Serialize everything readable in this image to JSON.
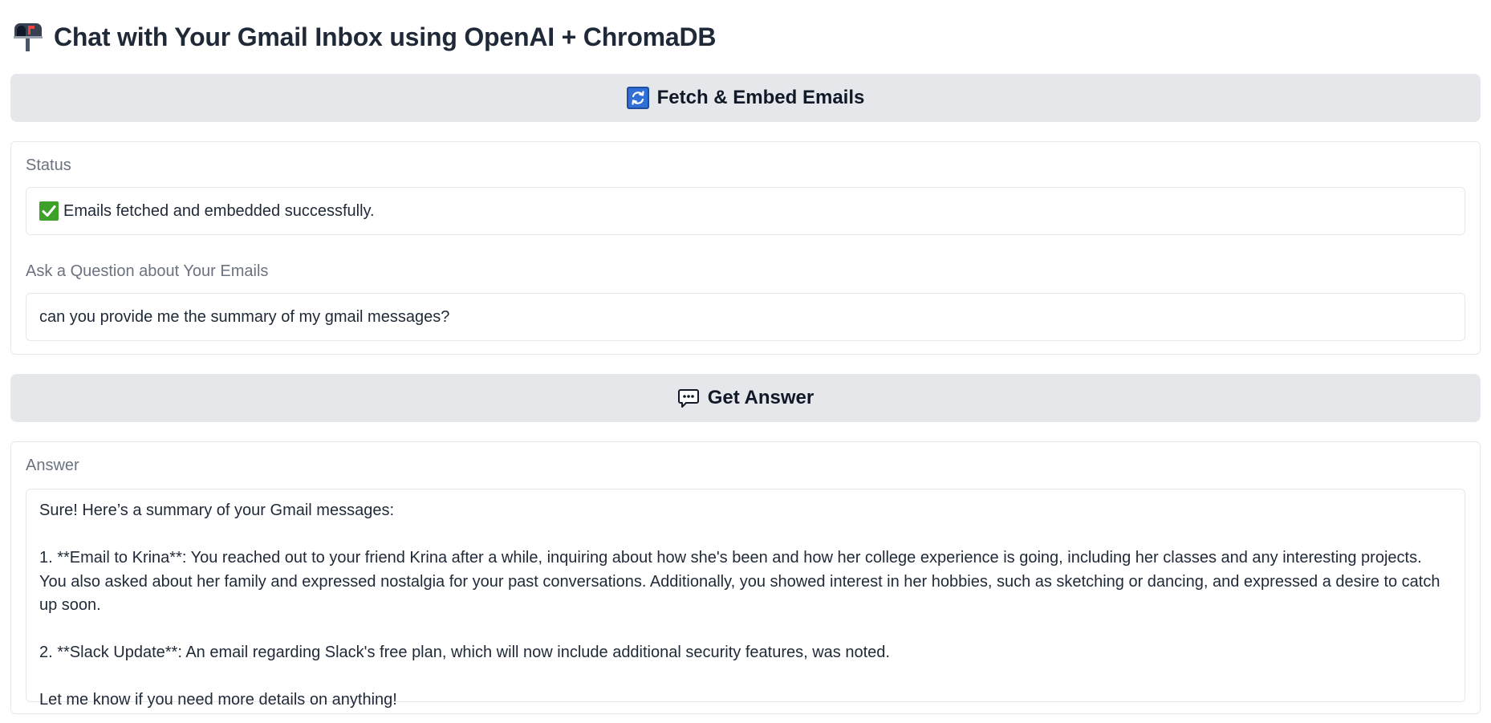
{
  "header": {
    "title": "Chat with Your Gmail Inbox using OpenAI + ChromaDB",
    "icon": "mailbox-icon"
  },
  "fetch_button": {
    "label": "Fetch & Embed Emails",
    "icon": "refresh-icon"
  },
  "status": {
    "label": "Status",
    "value": "Emails fetched and embedded successfully.",
    "icon": "check-icon"
  },
  "question": {
    "label": "Ask a Question about Your Emails",
    "value": "can you provide me the summary of my gmail messages?"
  },
  "answer_button": {
    "label": "Get Answer",
    "icon": "speech-bubble-icon"
  },
  "answer": {
    "label": "Answer",
    "paragraphs": [
      "Sure! Here’s a summary of your Gmail messages:",
      "1. **Email to Krina**: You reached out to your friend Krina after a while, inquiring about how she's been and how her college experience is going, including her classes and any interesting projects. You also asked about her family and expressed nostalgia for your past conversations. Additionally, you showed interest in her hobbies, such as sketching or dancing, and expressed a desire to catch up soon.",
      "2. **Slack Update**: An email regarding Slack's free plan, which will now include additional security features, was noted.",
      "Let me know if you need more details on anything!"
    ]
  },
  "colors": {
    "button_bg": "#e5e7eb",
    "panel_border": "#e5e7eb",
    "label_text": "#6b7280",
    "body_text": "#1f2937",
    "check_green": "#3fa02a",
    "refresh_blue": "#2f6fd6"
  }
}
